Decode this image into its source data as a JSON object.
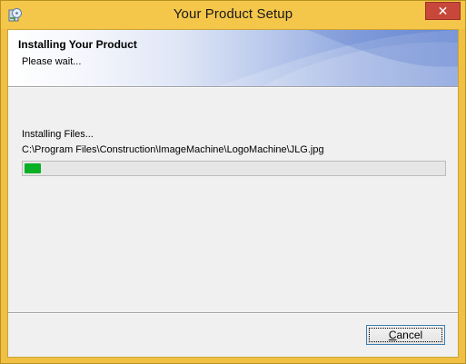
{
  "window": {
    "title": "Your Product Setup",
    "close_glyph": "✕",
    "app_icon": "setup-cd-icon",
    "frame_color": "#f0c044"
  },
  "banner": {
    "title": "Installing Your Product",
    "subtitle": "Please wait..."
  },
  "body": {
    "status_label": "Installing Files...",
    "file_path": "C:\\Program Files\\Construction\\ImageMachine\\LogoMachine\\JLG.jpg",
    "progress_fraction": 0.04,
    "progress_color": "#06b025"
  },
  "footer": {
    "cancel_label_mnemonic": "C",
    "cancel_label_rest": "ancel"
  }
}
